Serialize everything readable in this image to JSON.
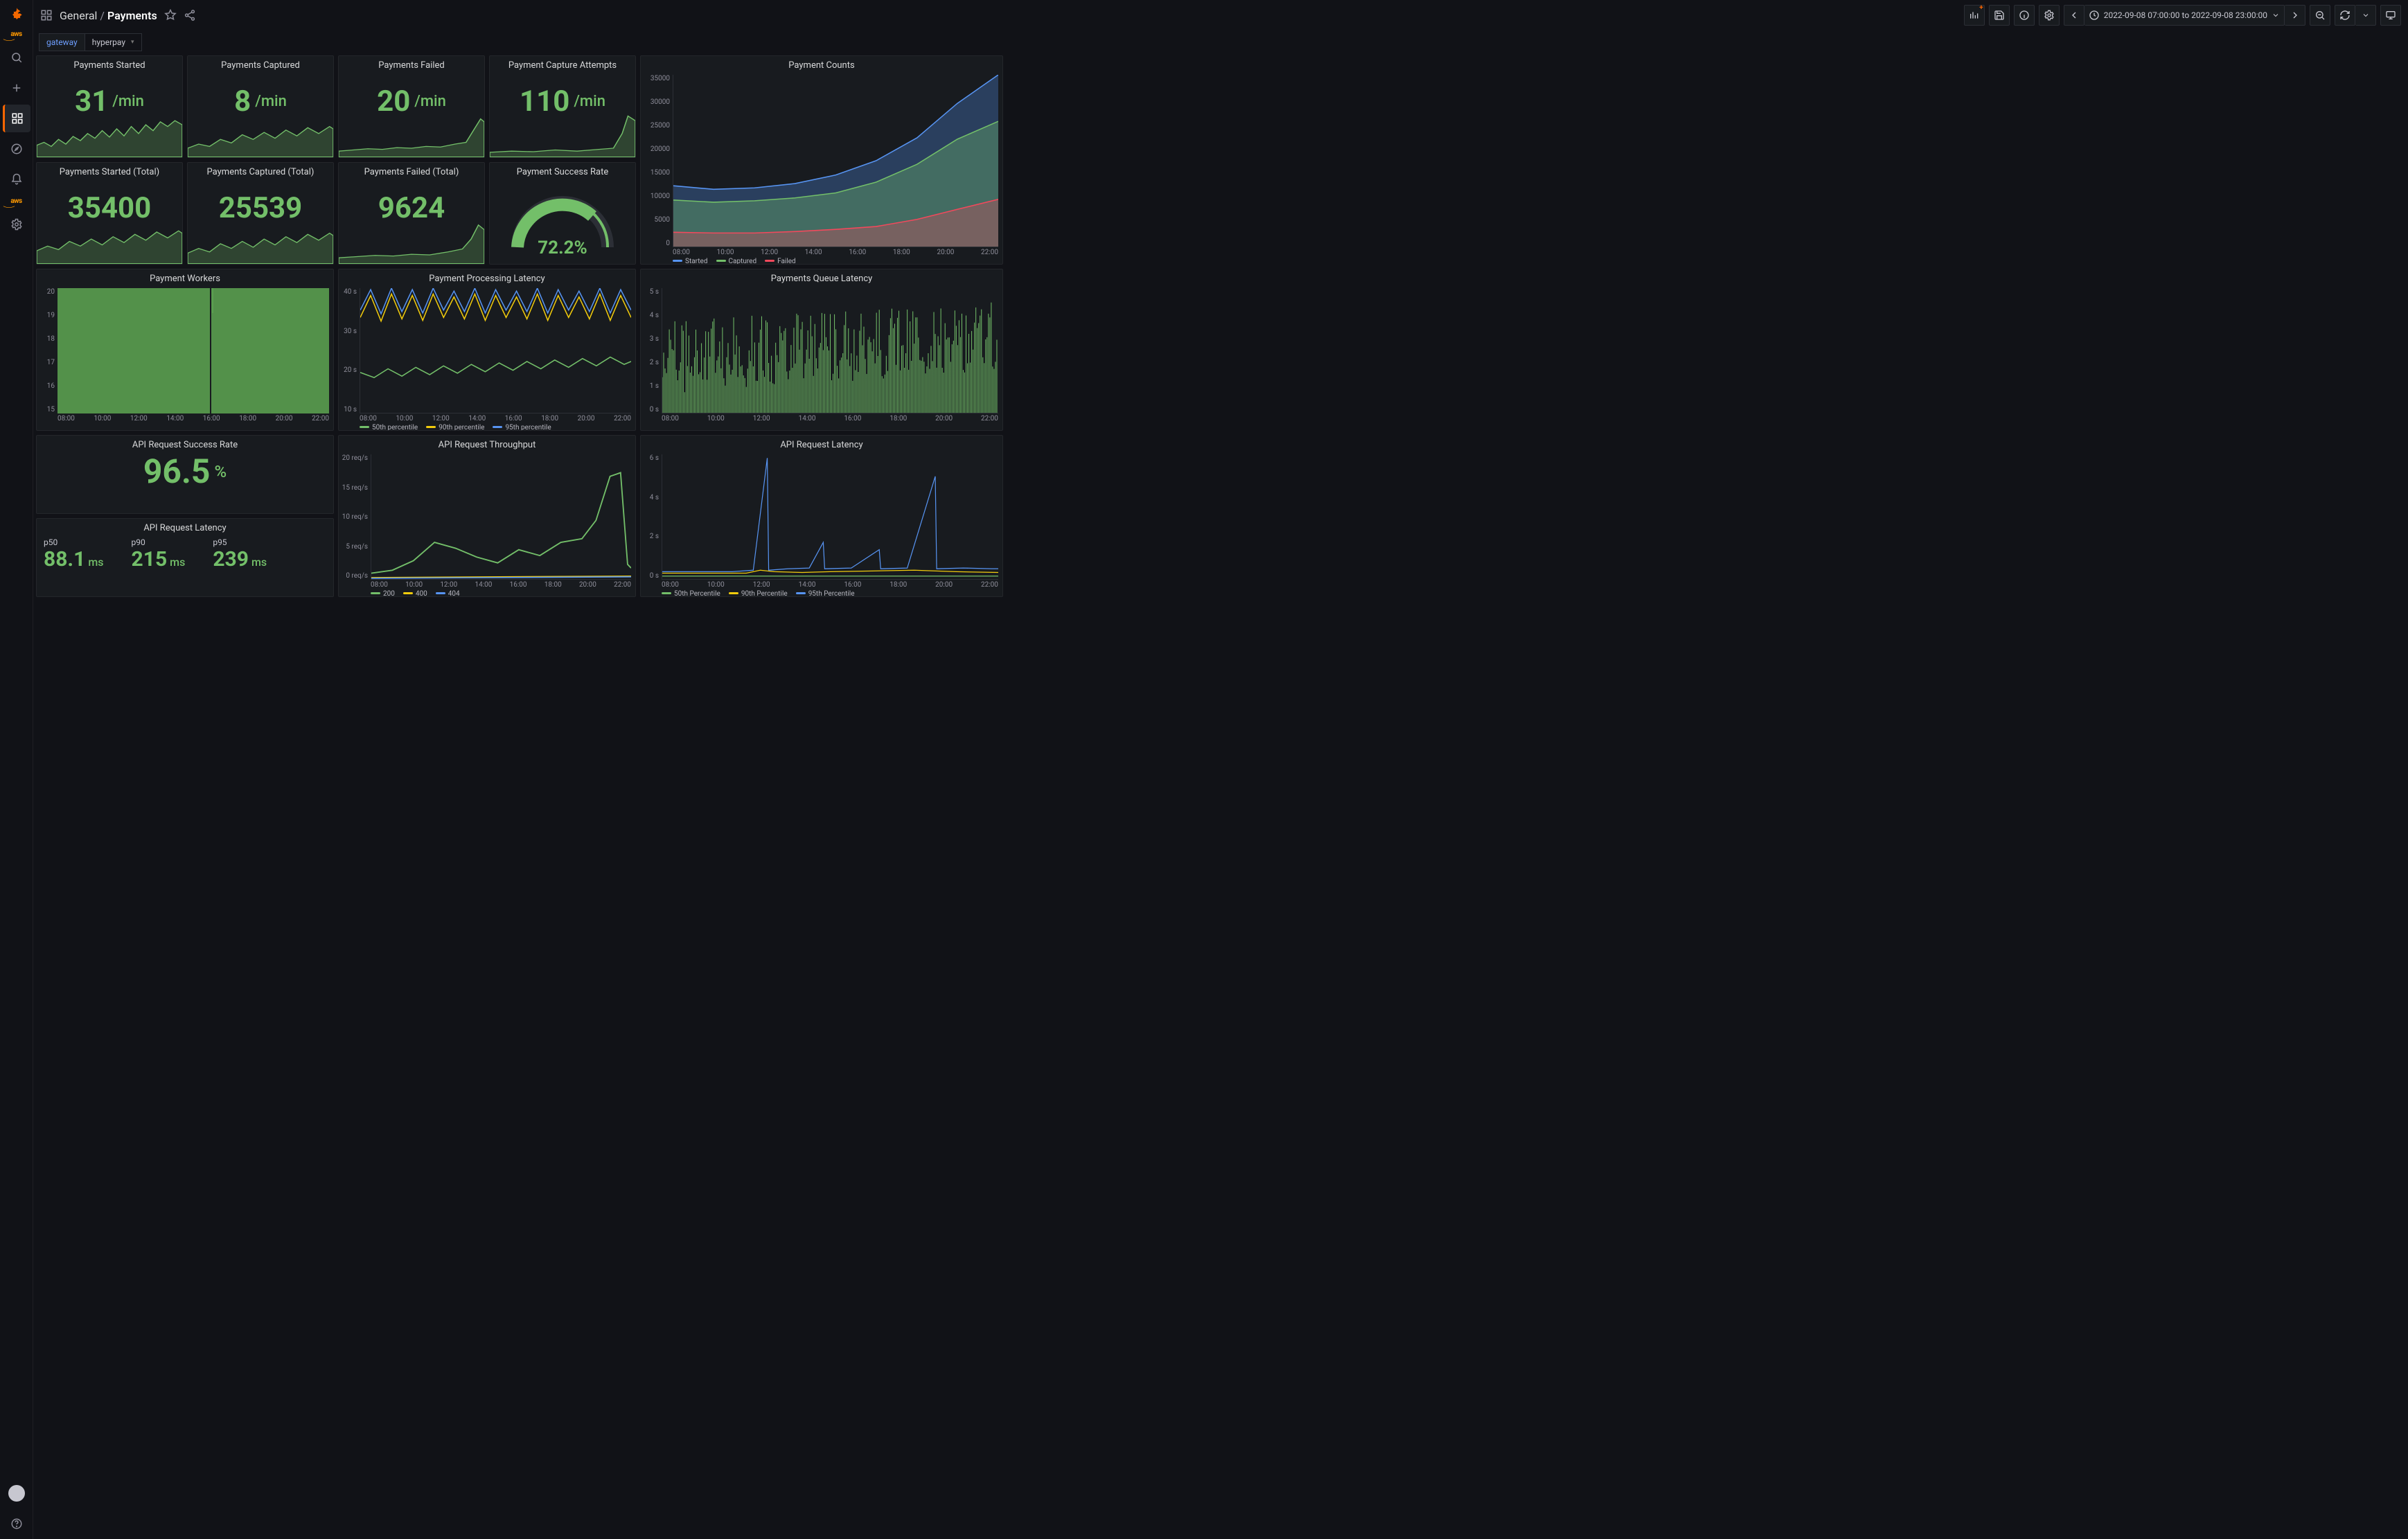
{
  "breadcrumb": {
    "folder": "General",
    "name": "Payments"
  },
  "timepicker": {
    "range": "2022-09-08 07:00:00 to 2022-09-08 23:00:00"
  },
  "variable": {
    "label": "gateway",
    "value": "hyperpay"
  },
  "sidebar_icons": [
    "grafana-logo",
    "aws-logo",
    "search",
    "create",
    "dashboards",
    "explore",
    "alerting",
    "aws",
    "configuration",
    "avatar",
    "help"
  ],
  "topbar_icons": [
    "dashboards-icon",
    "star-icon",
    "share-icon",
    "add-panel-icon",
    "save-icon",
    "info-icon",
    "settings-icon",
    "prev-icon",
    "clock-icon",
    "next-icon",
    "zoom-out-icon",
    "refresh-icon",
    "refresh-caret-icon",
    "monitor-icon"
  ],
  "stats": {
    "payments_started": {
      "title": "Payments Started",
      "value": "31",
      "unit": "/min"
    },
    "payments_captured": {
      "title": "Payments Captured",
      "value": "8",
      "unit": "/min"
    },
    "payments_failed": {
      "title": "Payments Failed",
      "value": "20",
      "unit": "/min"
    },
    "capture_attempts": {
      "title": "Payment Capture Attempts",
      "value": "110",
      "unit": "/min"
    },
    "payments_started_total": {
      "title": "Payments Started (Total)",
      "value": "35400",
      "unit": ""
    },
    "payments_captured_total": {
      "title": "Payments Captured (Total)",
      "value": "25539",
      "unit": ""
    },
    "payments_failed_total": {
      "title": "Payments Failed (Total)",
      "value": "9624",
      "unit": ""
    },
    "success_rate": {
      "title": "Payment Success Rate",
      "value": "72.2%"
    },
    "api_success_rate": {
      "title": "API Request Success Rate",
      "value": "96.5",
      "unit": "%"
    },
    "api_latency_stats": {
      "title": "API Request Latency",
      "p50": {
        "label": "p50",
        "value": "88.1",
        "unit": "ms"
      },
      "p90": {
        "label": "p90",
        "value": "215",
        "unit": "ms"
      },
      "p95": {
        "label": "p95",
        "value": "239",
        "unit": "ms"
      }
    }
  },
  "xcats": [
    "08:00",
    "10:00",
    "12:00",
    "14:00",
    "16:00",
    "18:00",
    "20:00",
    "22:00"
  ],
  "chart_data": [
    {
      "id": "payment_counts",
      "type": "area",
      "title": "Payment Counts",
      "categories": [
        "08:00",
        "10:00",
        "12:00",
        "14:00",
        "16:00",
        "18:00",
        "20:00",
        "22:00",
        "23:00"
      ],
      "series": [
        {
          "name": "Started",
          "color": "#5794F2",
          "values": [
            12500,
            12000,
            12200,
            12800,
            14000,
            17000,
            22000,
            29000,
            35400
          ]
        },
        {
          "name": "Captured",
          "color": "#73BF69",
          "values": [
            9500,
            9200,
            9400,
            9800,
            10500,
            13000,
            16500,
            21500,
            25539
          ]
        },
        {
          "name": "Failed",
          "color": "#F2495C",
          "values": [
            3000,
            2800,
            2800,
            3000,
            3500,
            4000,
            5500,
            7500,
            9624
          ]
        }
      ],
      "ylim": [
        0,
        35000
      ],
      "yticks": [
        0,
        5000,
        10000,
        15000,
        20000,
        25000,
        30000,
        35000
      ]
    },
    {
      "id": "payment_workers",
      "type": "area",
      "title": "Payment Workers",
      "categories": [
        "08:00",
        "10:00",
        "12:00",
        "14:00",
        "16:00",
        "18:00",
        "20:00",
        "22:00"
      ],
      "series": [
        {
          "name": "workers",
          "color": "#73BF69",
          "values": [
            20,
            20,
            20,
            20,
            20,
            20,
            20,
            20
          ]
        }
      ],
      "ylim": [
        15,
        20
      ],
      "yticks": [
        15,
        16,
        17,
        18,
        19,
        20
      ],
      "annotations": [
        {
          "x": "16:00",
          "dip_to": 15
        }
      ]
    },
    {
      "id": "processing_latency",
      "type": "line",
      "title": "Payment Processing Latency",
      "categories": [
        "08:00",
        "10:00",
        "12:00",
        "14:00",
        "16:00",
        "18:00",
        "20:00",
        "22:00"
      ],
      "series": [
        {
          "name": "50th percentile",
          "color": "#73BF69",
          "values": [
            22,
            20,
            23,
            21,
            24,
            22,
            25,
            23
          ]
        },
        {
          "name": "90th percentile",
          "color": "#F2CC0C",
          "values": [
            32,
            38,
            34,
            40,
            35,
            39,
            36,
            38
          ]
        },
        {
          "name": "95th percentile",
          "color": "#5794F2",
          "values": [
            35,
            41,
            37,
            42,
            38,
            42,
            40,
            42
          ]
        }
      ],
      "ylim": [
        10,
        40
      ],
      "yunit": "s",
      "yticks": [
        10,
        20,
        30,
        40
      ],
      "legend": [
        "50th percentile",
        "90th percentile",
        "95th percentile"
      ]
    },
    {
      "id": "queue_latency",
      "type": "bar",
      "title": "Payments Queue Latency",
      "categories": [
        "08:00",
        "10:00",
        "12:00",
        "14:00",
        "16:00",
        "18:00",
        "20:00",
        "22:00"
      ],
      "series": [
        {
          "name": "latency",
          "color": "#73BF69",
          "values": [
            2.5,
            1.8,
            3.0,
            2.6,
            3.8,
            2.9,
            3.5,
            3.0
          ]
        }
      ],
      "ylim": [
        0,
        5
      ],
      "yunit": "s",
      "yticks": [
        0,
        1,
        2,
        3,
        4,
        5
      ]
    },
    {
      "id": "api_throughput",
      "type": "line",
      "title": "API Request Throughput",
      "categories": [
        "08:00",
        "10:00",
        "12:00",
        "14:00",
        "16:00",
        "18:00",
        "20:00",
        "22:00",
        "23:00"
      ],
      "series": [
        {
          "name": "200",
          "color": "#73BF69",
          "values": [
            1,
            2,
            5,
            4,
            3,
            5,
            6,
            17,
            2
          ]
        },
        {
          "name": "400",
          "color": "#F2CC0C",
          "values": [
            0,
            0,
            0.3,
            0.2,
            0.2,
            0.3,
            0.4,
            0.8,
            0.2
          ]
        },
        {
          "name": "404",
          "color": "#5794F2",
          "values": [
            0,
            0,
            0.2,
            0.1,
            0.1,
            0.2,
            0.3,
            0.6,
            0.1
          ]
        }
      ],
      "ylim": [
        0,
        20
      ],
      "yunit": "req/s",
      "yticks": [
        0,
        5,
        10,
        15,
        20
      ],
      "legend": [
        "200",
        "400",
        "404"
      ]
    },
    {
      "id": "api_latency_ts",
      "type": "line",
      "title": "API Request Latency",
      "categories": [
        "08:00",
        "10:00",
        "12:00",
        "14:00",
        "16:00",
        "18:00",
        "20:00",
        "22:00"
      ],
      "series": [
        {
          "name": "50th Percentile",
          "color": "#73BF69",
          "values": [
            0.09,
            0.08,
            0.09,
            0.09,
            0.08,
            0.09,
            0.1,
            0.09
          ]
        },
        {
          "name": "90th Percentile",
          "color": "#F2CC0C",
          "values": [
            0.2,
            0.22,
            0.25,
            0.24,
            0.22,
            0.25,
            0.3,
            0.24
          ]
        },
        {
          "name": "95th Percentile",
          "color": "#5794F2",
          "values": [
            0.25,
            0.3,
            6.2,
            0.3,
            0.28,
            0.35,
            4.5,
            0.3
          ]
        }
      ],
      "ylim": [
        0,
        6
      ],
      "yunit": "s",
      "yticks": [
        0,
        2,
        4,
        6
      ],
      "legend": [
        "50th Percentile",
        "90th Percentile",
        "95th Percentile"
      ]
    }
  ]
}
